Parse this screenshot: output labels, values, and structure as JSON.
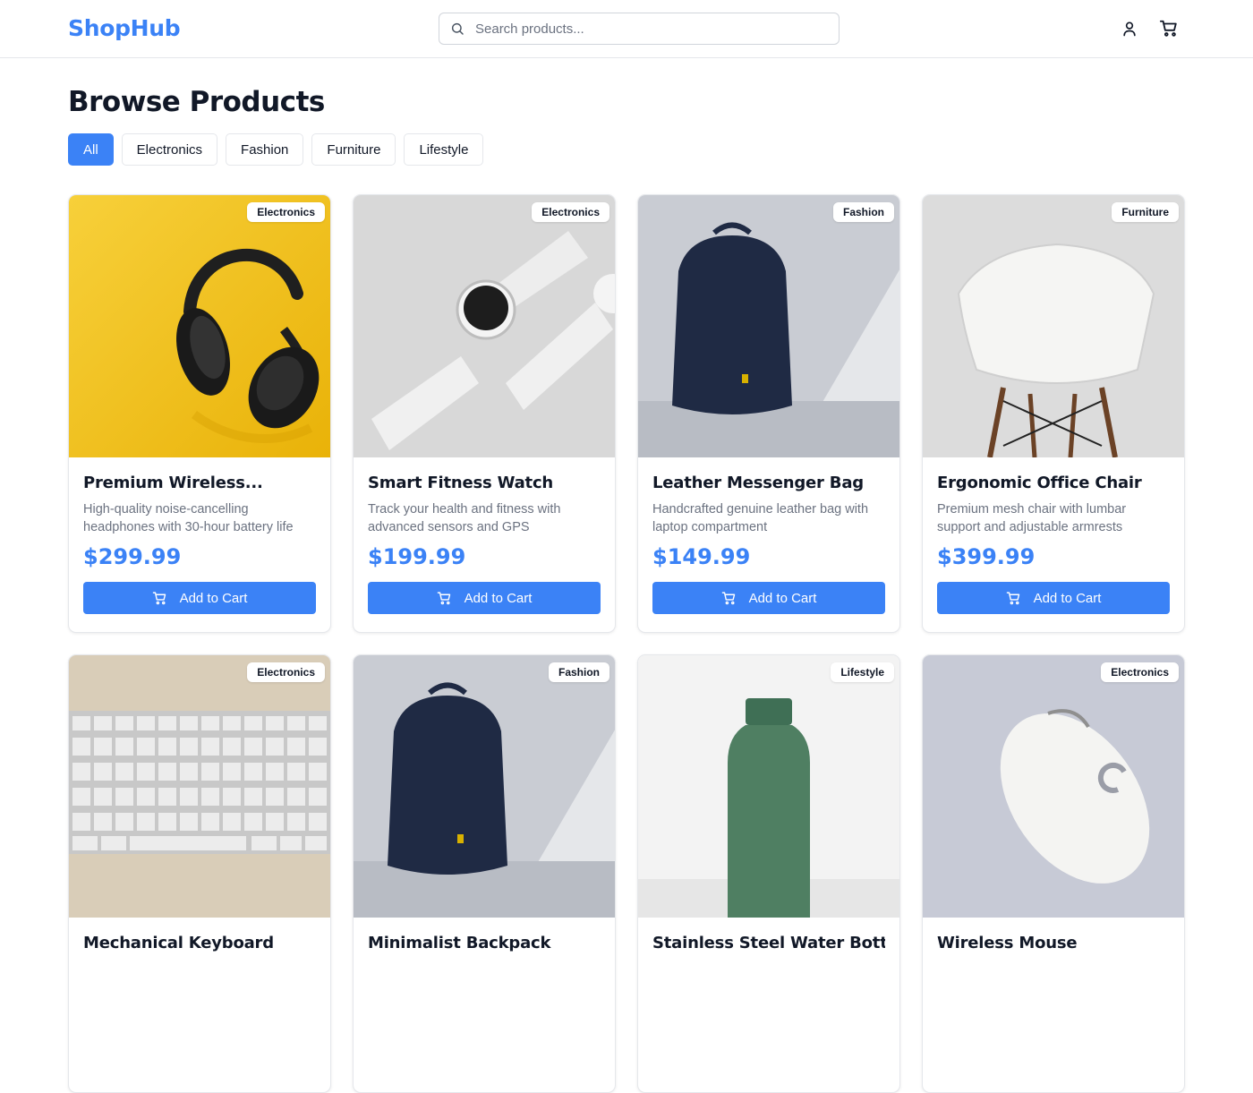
{
  "header": {
    "logo": "ShopHub",
    "search_placeholder": "Search products...",
    "icons": [
      "user-icon",
      "cart-icon"
    ]
  },
  "page": {
    "title": "Browse Products"
  },
  "filters": [
    "All",
    "Electronics",
    "Fashion",
    "Furniture",
    "Lifestyle"
  ],
  "active_filter": "All",
  "colors": {
    "accent": "#3b82f6",
    "text": "#111827",
    "muted": "#6b7280",
    "border": "#e5e7eb"
  },
  "add_to_cart_label": "Add to Cart",
  "products": [
    {
      "name": "Premium Wireless...",
      "category": "Electronics",
      "description": "High-quality noise-cancelling headphones with 30-hour battery life",
      "price": "$299.99"
    },
    {
      "name": "Smart Fitness Watch",
      "category": "Electronics",
      "description": "Track your health and fitness with advanced sensors and GPS",
      "price": "$199.99"
    },
    {
      "name": "Leather Messenger Bag",
      "category": "Fashion",
      "description": "Handcrafted genuine leather bag with laptop compartment",
      "price": "$149.99"
    },
    {
      "name": "Ergonomic Office Chair",
      "category": "Furniture",
      "description": "Premium mesh chair with lumbar support and adjustable armrests",
      "price": "$399.99"
    },
    {
      "name": "Mechanical Keyboard",
      "category": "Electronics",
      "description": "",
      "price": ""
    },
    {
      "name": "Minimalist Backpack",
      "category": "Fashion",
      "description": "",
      "price": ""
    },
    {
      "name": "Stainless Steel Water Bottle",
      "category": "Lifestyle",
      "description": "",
      "price": ""
    },
    {
      "name": "Wireless Mouse",
      "category": "Electronics",
      "description": "",
      "price": ""
    }
  ]
}
